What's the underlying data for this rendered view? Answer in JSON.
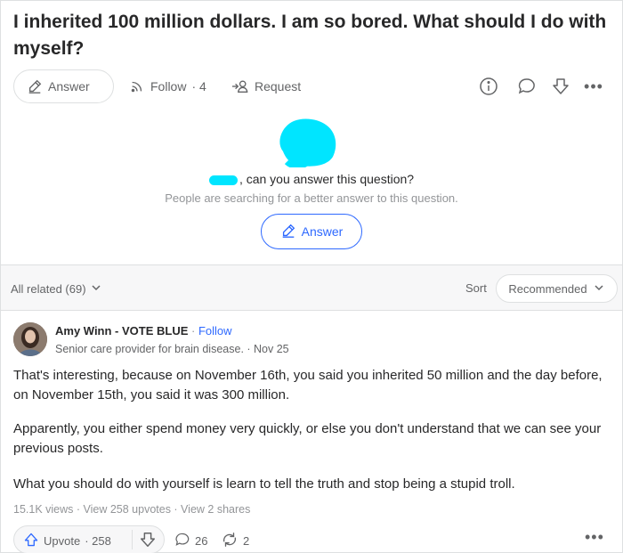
{
  "question": {
    "title": "I inherited 100 million dollars. I am so bored. What should I do with myself?",
    "actions": {
      "answer_label": "Answer",
      "follow_label": "Follow",
      "follow_count": "· 4",
      "request_label": "Request"
    }
  },
  "cta": {
    "prompt": ", can you answer this question?",
    "subtext": "People are searching for a better answer to this question.",
    "answer_button": "Answer"
  },
  "related": {
    "label": "All related (69)",
    "sort_label": "Sort",
    "sort_value": "Recommended"
  },
  "answer": {
    "author_name": "Amy Winn - VOTE BLUE",
    "separator": " · ",
    "follow_label": "Follow",
    "credential": "Senior care provider for brain disease. · Nov 25",
    "paragraphs": [
      "That's interesting, because on November 16th, you said you inherited 50 million and the day before, on November 15th, you said it was 300 million.",
      "Apparently, you either spend money very quickly, or else you don't understand that we can see your previous posts.",
      "What you should do with yourself is learn to tell the truth and stop being a stupid troll."
    ],
    "stats": "15.1K views · View 258 upvotes · View 2 shares",
    "upvote_label": "Upvote",
    "upvote_count": "· 258",
    "comment_count": "26",
    "share_count": "2"
  },
  "colors": {
    "accent": "#2e69ff",
    "redaction": "#00e5ff",
    "text": "#282829",
    "muted": "#636466",
    "border": "#dee0e1",
    "bar_bg": "#f7f7f8"
  }
}
